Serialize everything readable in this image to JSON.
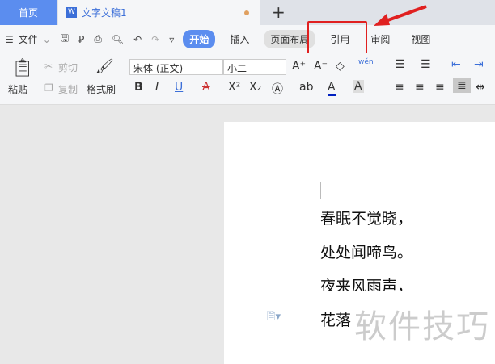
{
  "tabs": {
    "home": "首页",
    "doc_icon": "W",
    "doc": "文字文稿1",
    "new": "+"
  },
  "toolbar": {
    "file": "文件",
    "menus": [
      "开始",
      "插入",
      "页面布局",
      "引用",
      "审阅",
      "视图"
    ]
  },
  "ribbon": {
    "paste": "粘贴",
    "cut": "剪切",
    "copy": "复制",
    "format_painter": "格式刷",
    "font": "宋体 (正文)",
    "size": "小二",
    "bold": "B",
    "italic": "I",
    "underline": "U",
    "strike": "A",
    "superscript": "X²",
    "subscript": "X₂",
    "font_color": "A",
    "highlight": "A",
    "phonetic": "wén"
  },
  "document": {
    "lines": [
      "春眠不觉晓，",
      "处处闻啼鸟。",
      "夜来风雨声，",
      "花落知多少。"
    ]
  },
  "watermark": "软件技巧",
  "colors": {
    "accent": "#5b8def",
    "highlight_box": "#e02020"
  }
}
